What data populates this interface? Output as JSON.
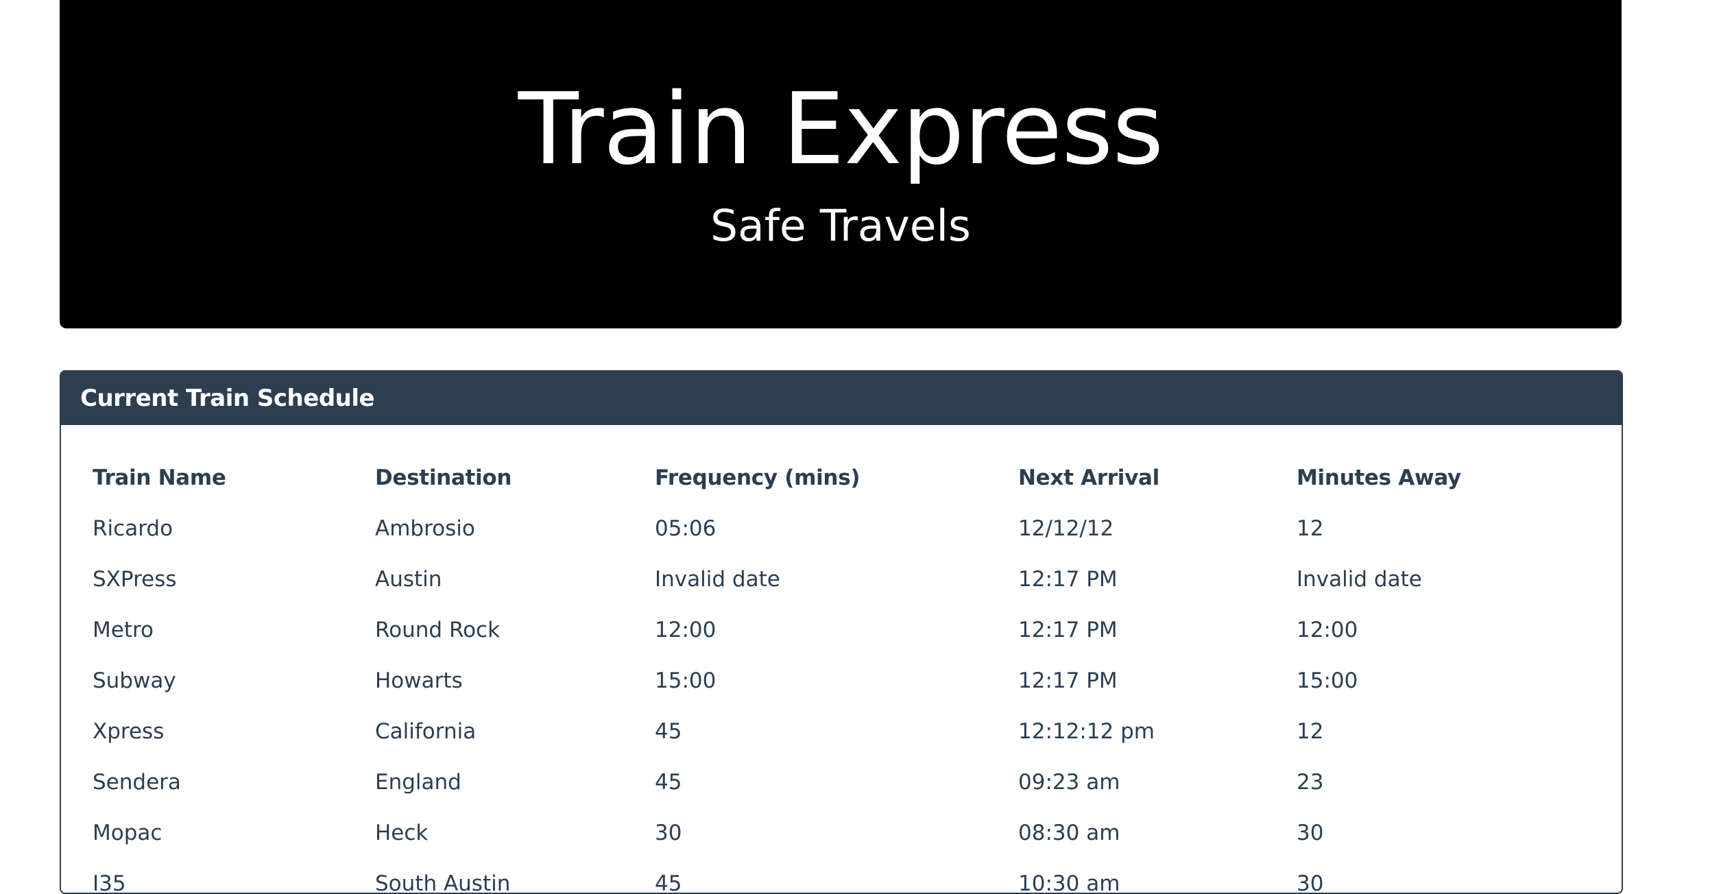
{
  "jumbotron": {
    "title": "Train Express",
    "subtitle": "Safe Travels"
  },
  "schedule": {
    "panel_title": "Current Train Schedule",
    "columns": [
      "Train Name",
      "Destination",
      "Frequency (mins)",
      "Next Arrival",
      "Minutes Away"
    ],
    "rows": [
      [
        "Ricardo",
        "Ambrosio",
        "05:06",
        "12/12/12",
        "12"
      ],
      [
        "SXPress",
        "Austin",
        "Invalid date",
        "12:17 PM",
        "Invalid date"
      ],
      [
        "Metro",
        "Round Rock",
        "12:00",
        "12:17 PM",
        "12:00"
      ],
      [
        "Subway",
        "Howarts",
        "15:00",
        "12:17 PM",
        "15:00"
      ],
      [
        "Xpress",
        "California",
        "45",
        "12:12:12 pm",
        "12"
      ],
      [
        "Sendera",
        "England",
        "45",
        "09:23 am",
        "23"
      ],
      [
        "Mopac",
        "Heck",
        "30",
        "08:30 am",
        "30"
      ],
      [
        "I35",
        "South Austin",
        "45",
        "10:30 am",
        "30"
      ]
    ]
  },
  "colors": {
    "jumbotron_bg": "#000000",
    "panel_heading_bg": "#2c3e50",
    "text": "#2c3e50"
  }
}
